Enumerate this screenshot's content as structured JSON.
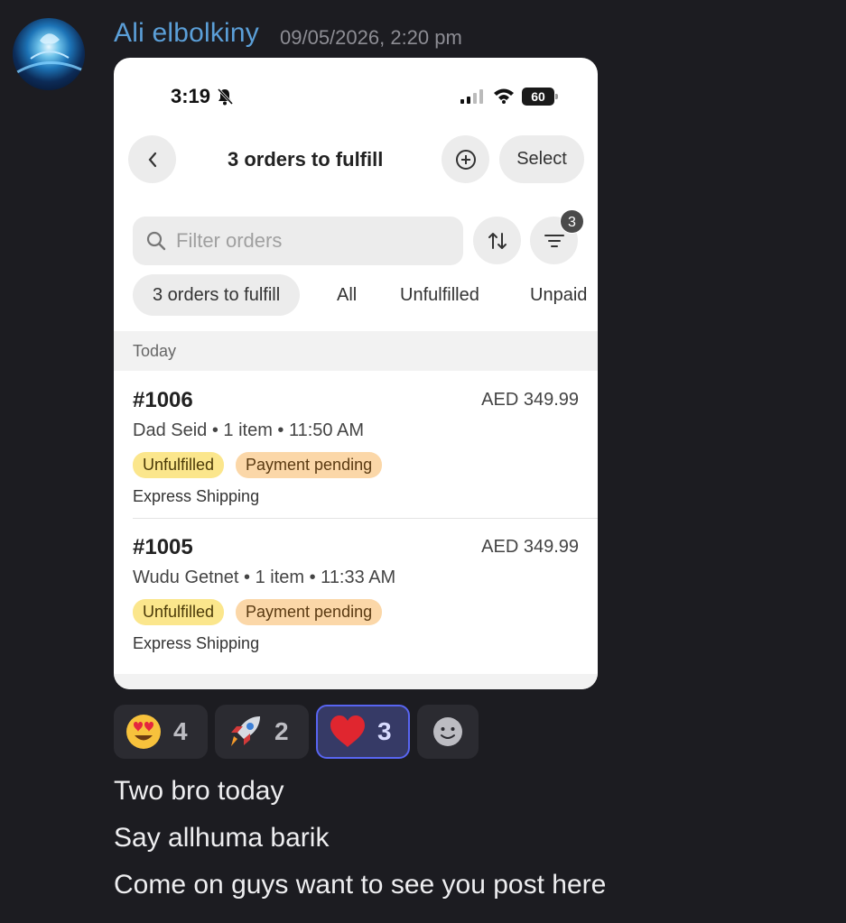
{
  "message": {
    "author": "Ali elbolkiny",
    "timestamp": "09/05/2026, 2:20 pm",
    "lines": [
      "Two bro today",
      "Say allhuma barik",
      "Come on guys want to see you post here"
    ]
  },
  "phone": {
    "status": {
      "time": "3:19",
      "battery": "60"
    },
    "nav": {
      "title": "3 orders to fulfill",
      "select_label": "Select"
    },
    "search": {
      "placeholder": "Filter orders"
    },
    "filter_count": "3",
    "chips": [
      "3 orders to fulfill",
      "All",
      "Unfulfilled",
      "Unpaid"
    ],
    "section": "Today",
    "orders": [
      {
        "id": "#1006",
        "amount": "AED 349.99",
        "meta": "Dad Seid • 1 item • 11:50 AM",
        "fulfillment": "Unfulfilled",
        "payment": "Payment pending",
        "shipping": "Express Shipping"
      },
      {
        "id": "#1005",
        "amount": "AED 349.99",
        "meta": "Wudu Getnet • 1 item • 11:33 AM",
        "fulfillment": "Unfulfilled",
        "payment": "Payment pending",
        "shipping": "Express Shipping"
      }
    ]
  },
  "reactions": [
    {
      "emoji": "heart-eyes-face",
      "count": "4"
    },
    {
      "emoji": "rocket",
      "count": "2"
    },
    {
      "emoji": "red-heart",
      "count": "3",
      "active": true
    }
  ],
  "colors": {
    "background": "#1c1c21",
    "author": "#5b9fd8",
    "active_reaction_border": "#5865f2",
    "unfulfilled_badge": "#fbe68c",
    "payment_badge": "#fbd7a8"
  }
}
